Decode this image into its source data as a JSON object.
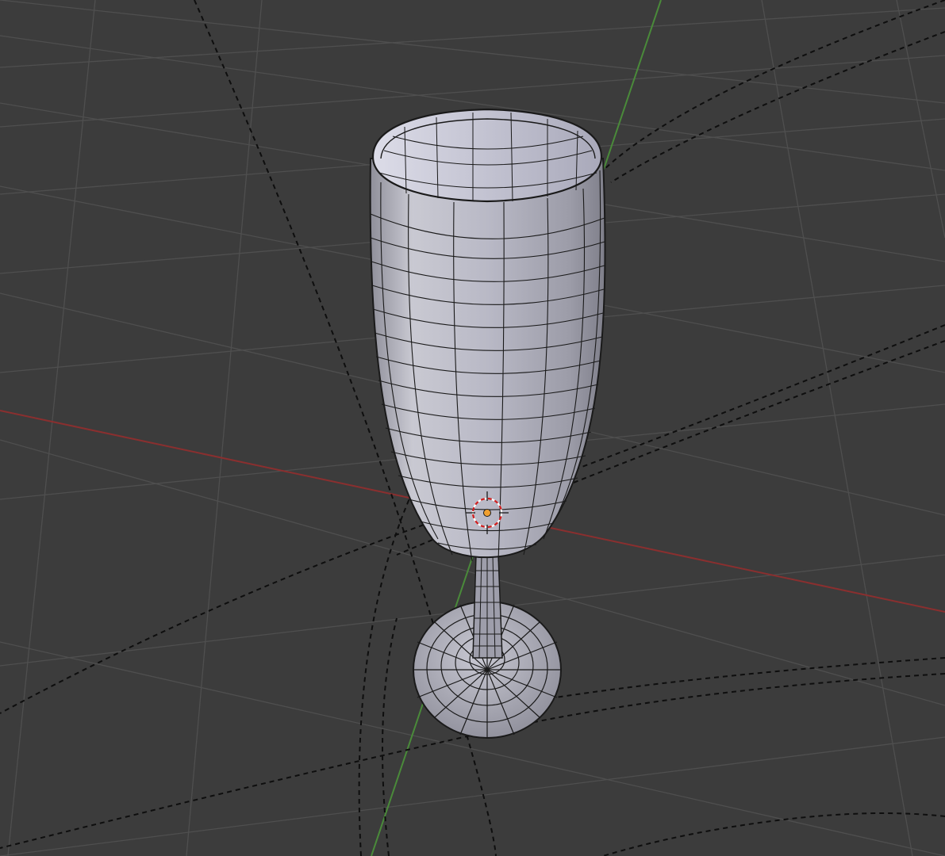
{
  "viewport": {
    "view": "3D Viewport",
    "shading": "solid",
    "mode": "edit-mode-mesh-wireframe-overlay"
  },
  "scene": {
    "object_name": "",
    "object_type": "champagne-flute-mesh",
    "icons": {
      "origin": "object-origin-icon",
      "cursor": "3d-cursor-icon"
    }
  },
  "colors": {
    "background": "#3c3c3c",
    "grid": "#4f4f4f",
    "x_axis": "#8a2f2f",
    "y_axis": "#4a8a3a",
    "mesh_face": "#b6b6c4",
    "mesh_edge": "#1a1a1a",
    "origin": "#f0a030",
    "cursor_red": "#d02020"
  }
}
